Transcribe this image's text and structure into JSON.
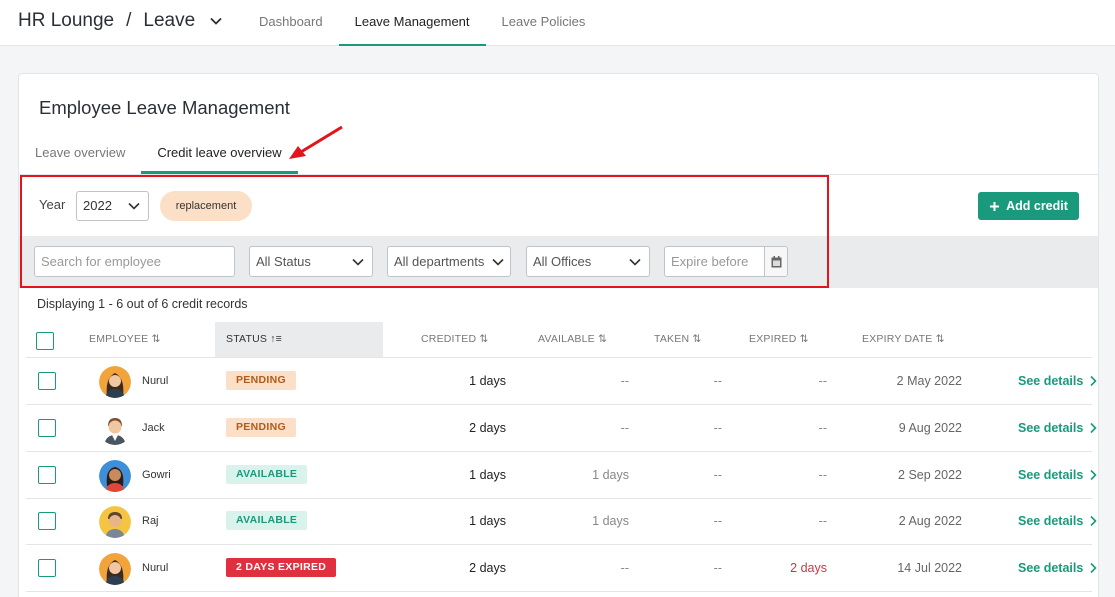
{
  "app": {
    "brand": "HR Lounge",
    "separator": "/",
    "module": "Leave"
  },
  "top_nav": [
    {
      "label": "Dashboard",
      "active": false
    },
    {
      "label": "Leave Management",
      "active": true
    },
    {
      "label": "Leave Policies",
      "active": false
    }
  ],
  "page": {
    "title": "Employee Leave Management",
    "tabs": [
      {
        "label": "Leave overview",
        "active": false
      },
      {
        "label": "Credit leave overview",
        "active": true
      }
    ]
  },
  "filters": {
    "year_label": "Year",
    "year_value": "2022",
    "chip": "replacement",
    "add_button": "Add credit",
    "search_placeholder": "Search for employee",
    "status_value": "All Status",
    "departments_value": "All departments",
    "offices_value": "All Offices",
    "expire_placeholder": "Expire before"
  },
  "summary": "Displaying 1 - 6 out of 6 credit records",
  "table": {
    "headers": {
      "employee": "EMPLOYEE",
      "status": "STATUS",
      "credited": "CREDITED",
      "available": "AVAILABLE",
      "taken": "TAKEN",
      "expired": "EXPIRED",
      "expiry_date": "EXPIRY DATE"
    },
    "rows": [
      {
        "name": "Nurul",
        "status": "PENDING",
        "credited": "1 days",
        "available": "--",
        "taken": "--",
        "expired": "--",
        "expiry_date": "2 May 2022",
        "action": "See details"
      },
      {
        "name": "Jack",
        "status": "PENDING",
        "credited": "2 days",
        "available": "--",
        "taken": "--",
        "expired": "--",
        "expiry_date": "9 Aug 2022",
        "action": "See details"
      },
      {
        "name": "Gowri",
        "status": "AVAILABLE",
        "credited": "1 days",
        "available": "1 days",
        "taken": "--",
        "expired": "--",
        "expiry_date": "2 Sep 2022",
        "action": "See details"
      },
      {
        "name": "Raj",
        "status": "AVAILABLE",
        "credited": "1 days",
        "available": "1 days",
        "taken": "--",
        "expired": "--",
        "expiry_date": "2 Aug 2022",
        "action": "See details"
      },
      {
        "name": "Nurul",
        "status": "2 DAYS EXPIRED",
        "credited": "2 days",
        "available": "--",
        "taken": "--",
        "expired": "2 days",
        "expiry_date": "14 Jul 2022",
        "action": "See details"
      }
    ]
  },
  "colors": {
    "accent": "#199a7d",
    "highlight": "#e3141b",
    "pending_bg": "#fbdfc7",
    "available_bg": "#d9f3ec",
    "expired_bg": "#e02f3e"
  }
}
